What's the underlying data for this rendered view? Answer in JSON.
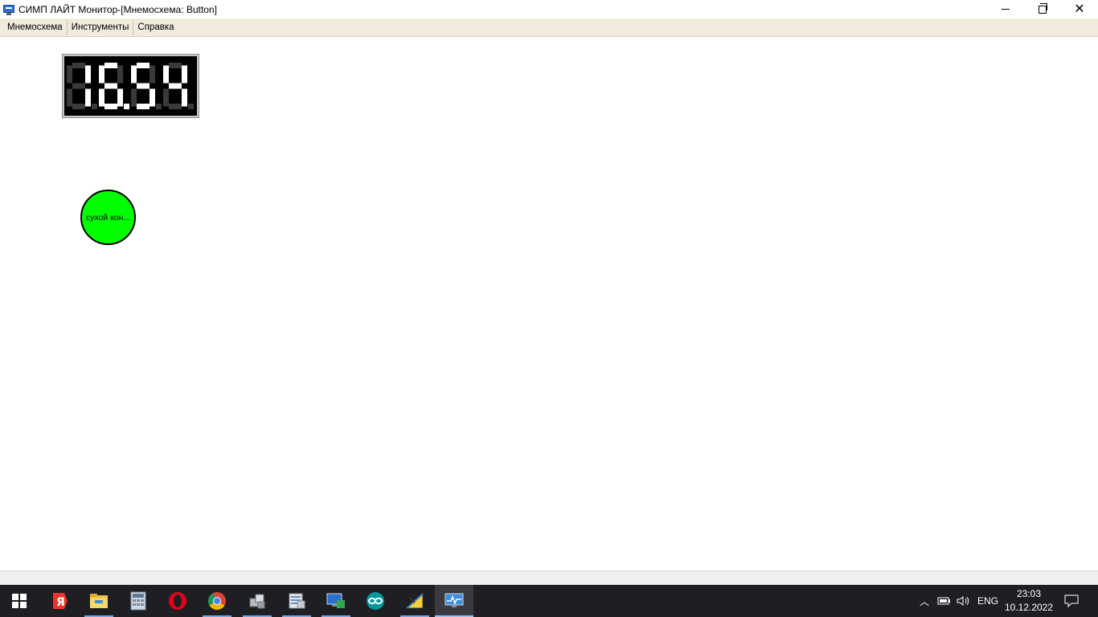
{
  "window": {
    "title": "СИМП ЛАЙТ Монитор-[Мнемосхема: Button]"
  },
  "menu": {
    "items": [
      "Мнемосхема",
      "Инструменты",
      "Справка"
    ]
  },
  "display": {
    "value": "16.54",
    "digit_color": "#ffffff",
    "dim_color": "#3a3a3a",
    "background": "#000000"
  },
  "indicator": {
    "label": "сухой кон...",
    "color": "#00ff00"
  },
  "taskbar": {
    "apps": [
      {
        "name": "start-icon"
      },
      {
        "name": "yandex-browser-icon"
      },
      {
        "name": "file-explorer-icon"
      },
      {
        "name": "calculator-icon"
      },
      {
        "name": "opera-icon"
      },
      {
        "name": "chrome-icon"
      },
      {
        "name": "app-modules-icon"
      },
      {
        "name": "database-icon"
      },
      {
        "name": "monitor-app-icon"
      },
      {
        "name": "arduino-icon"
      },
      {
        "name": "drafting-icon"
      },
      {
        "name": "simp-monitor-icon"
      }
    ],
    "tray": {
      "language": "ENG",
      "time": "23:03",
      "date": "10.12.2022"
    }
  }
}
